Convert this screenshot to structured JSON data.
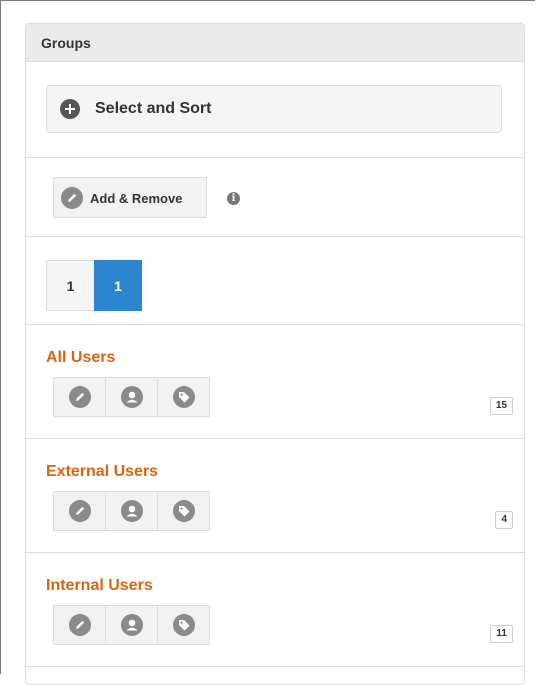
{
  "panel": {
    "heading": "Groups"
  },
  "select_sort": {
    "label": "Select and Sort",
    "icon": "plus-circle-icon"
  },
  "add_remove": {
    "label": "Add & Remove",
    "icon": "pencil-icon",
    "info_icon": "info-icon",
    "info_glyph": "i"
  },
  "pager": {
    "pages": [
      "1",
      "1"
    ],
    "active_index": 1
  },
  "groups": [
    {
      "name": "All Users",
      "count": "15"
    },
    {
      "name": "External Users",
      "count": "4"
    },
    {
      "name": "Internal Users",
      "count": "11"
    }
  ],
  "group_actions": [
    "pencil-icon",
    "user-icon",
    "tag-icon"
  ],
  "colors": {
    "accent_orange": "#d8650f",
    "active_blue": "#2b86cf",
    "icon_gray": "#8a8a8a"
  }
}
